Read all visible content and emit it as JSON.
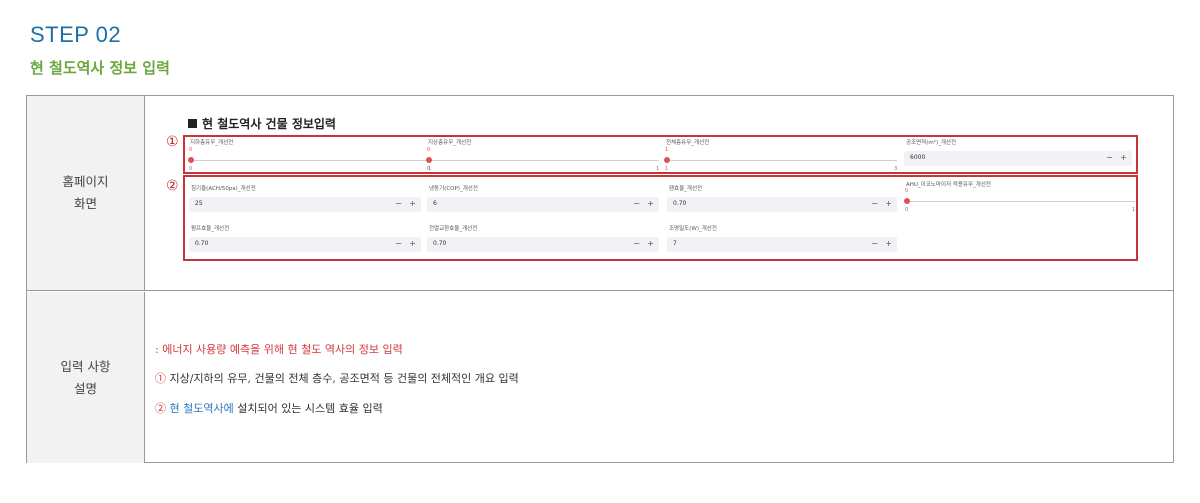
{
  "header": {
    "step": "STEP 02",
    "subtitle": "현 철도역사 정보 입력"
  },
  "table": {
    "row1_label_line1": "홈페이지",
    "row1_label_line2": "화면",
    "row2_label_line1": "입력 사항",
    "row2_label_line2": "설명"
  },
  "screen": {
    "heading": "현 철도역사 건물 정보입력",
    "marker1": "①",
    "marker2": "②",
    "group1": {
      "slider1": {
        "label": "지하층유무_개선전",
        "value": "0",
        "min": "0",
        "max": "1"
      },
      "slider2": {
        "label": "지상층유무_개선전",
        "value": "0",
        "min": "0",
        "max": "1"
      },
      "slider3": {
        "label": "전체층유무_개선전",
        "value": "1",
        "min": "1",
        "max": "3"
      },
      "area": {
        "label": "공조면적(m²)_개선전",
        "value": "6000",
        "minus": "−",
        "plus": "+"
      }
    },
    "group2": {
      "ach": {
        "label": "침기율(ACH/50pa)_개선전",
        "value": "25",
        "minus": "−",
        "plus": "+"
      },
      "cop": {
        "label": "냉동기(COP)_개선전",
        "value": "6",
        "minus": "−",
        "plus": "+"
      },
      "fan": {
        "label": "팬효율_개선전",
        "value": "0.70",
        "minus": "−",
        "plus": "+"
      },
      "ahu": {
        "label": "AHU_이코노마이저 적용유무_개선전",
        "value": "0",
        "min": "0",
        "max": "1"
      },
      "pump": {
        "label": "펌프효율_개선전",
        "value": "0.70",
        "minus": "−",
        "plus": "+"
      },
      "hrv": {
        "label": "전열교환효율_개선전",
        "value": "0.70",
        "minus": "−",
        "plus": "+"
      },
      "light": {
        "label": "조명밀도(W)_개선전",
        "value": "7",
        "minus": "−",
        "plus": "+"
      }
    }
  },
  "description": {
    "line1": ": 에너지 사용량 예측을 위해 현 철도 역사의 정보 입력",
    "line2_marker": "①",
    "line2_text": " 지상/지하의 유무, 건물의 전체 층수, 공조면적 등 건물의 전체적인 개요 입력",
    "line3_marker": "②",
    "line3_highlight": " 현 철도역사에",
    "line3_text": " 설치되어 있는 시스템 효율 입력"
  },
  "colors": {
    "step_title": "#1d6fa8",
    "subtitle": "#6aa83c",
    "highlight_box": "#c8333a",
    "emphasis_red": "#d4373c",
    "emphasis_blue": "#2f74c0"
  }
}
